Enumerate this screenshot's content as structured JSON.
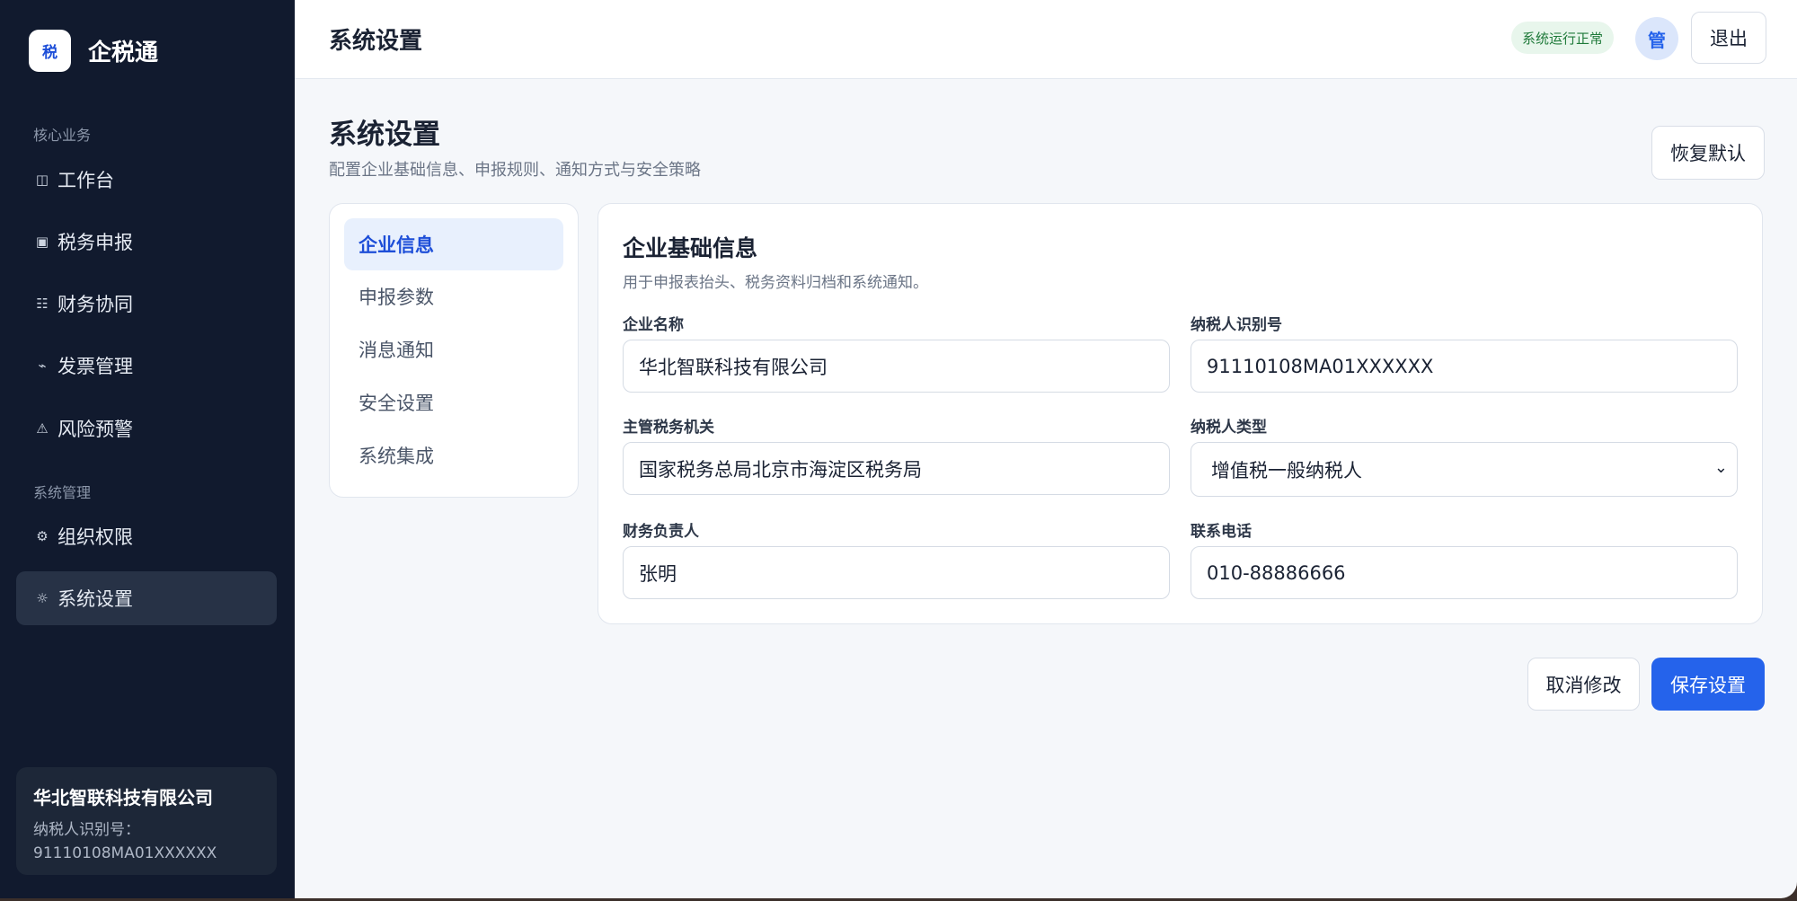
{
  "brand": {
    "logo_text": "税",
    "name": "企税通"
  },
  "sidebar": {
    "section_core": "核心业务",
    "section_system": "系统管理",
    "items": [
      {
        "icon": "◫",
        "icon_name": "dashboard-icon",
        "label": "工作台"
      },
      {
        "icon": "▣",
        "icon_name": "tax-filing-icon",
        "label": "税务申报"
      },
      {
        "icon": "☷",
        "icon_name": "finance-collab-icon",
        "label": "财务协同"
      },
      {
        "icon": "⌁",
        "icon_name": "invoice-icon",
        "label": "发票管理"
      },
      {
        "icon": "⚠",
        "icon_name": "warning-icon",
        "label": "风险预警"
      },
      {
        "icon": "⚙",
        "icon_name": "org-permission-icon",
        "label": "组织权限"
      },
      {
        "icon": "☼",
        "icon_name": "settings-icon",
        "label": "系统设置"
      }
    ],
    "company_card": {
      "name": "华北智联科技有限公司",
      "tax_label": "纳税人识别号：",
      "tax_id": "91110108MA01XXXXXX"
    }
  },
  "topbar": {
    "title": "系统设置",
    "status": "系统运行正常",
    "avatar_text": "管",
    "logout_label": "退出"
  },
  "page": {
    "title": "系统设置",
    "subtitle": "配置企业基础信息、申报规则、通知方式与安全策略",
    "reset_label": "恢复默认"
  },
  "settings_nav": {
    "items": [
      "企业信息",
      "申报参数",
      "消息通知",
      "安全设置",
      "系统集成"
    ],
    "active_index": 0
  },
  "form": {
    "title": "企业基础信息",
    "subtitle": "用于申报表抬头、税务资料归档和系统通知。",
    "company_name": {
      "label": "企业名称",
      "value": "华北智联科技有限公司"
    },
    "taxpayer_id": {
      "label": "纳税人识别号",
      "value": "91110108MA01XXXXXX"
    },
    "tax_authority": {
      "label": "主管税务机关",
      "value": "国家税务总局北京市海淀区税务局"
    },
    "taxpayer_type": {
      "label": "纳税人类型",
      "value": "增值税一般纳税人"
    },
    "finance_owner": {
      "label": "财务负责人",
      "value": "张明"
    },
    "phone": {
      "label": "联系电话",
      "value": "010-88886666"
    }
  },
  "actions": {
    "cancel_label": "取消修改",
    "save_label": "保存设置"
  },
  "colors": {
    "accent": "#2563eb",
    "sidebar_bg": "#111a2e",
    "status_green": "#1f7a3a"
  }
}
